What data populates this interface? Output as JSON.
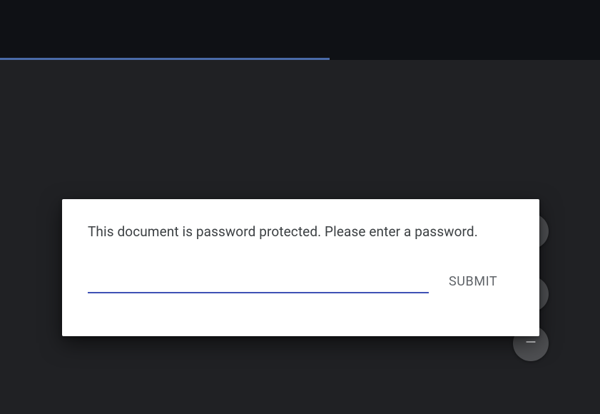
{
  "dialog": {
    "message": "This document is password protected. Please enter a password.",
    "submit_label": "SUBMIT",
    "password_value": ""
  },
  "controls": {
    "fit_icon": "fit-to-page-icon",
    "zoom_in_icon": "plus-icon",
    "zoom_out_icon": "minus-icon"
  }
}
